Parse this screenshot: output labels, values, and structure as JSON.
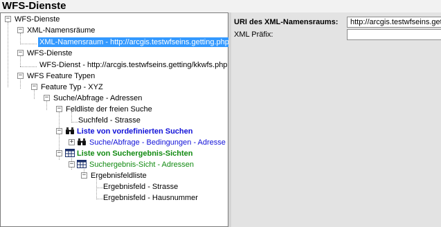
{
  "window": {
    "title": "WFS-Dienste"
  },
  "tree": {
    "root": "WFS-Dienste",
    "xml_namespaces": "XML-Namensräume",
    "xml_namespace_item": "XML-Namensraum - http://arcgis.testwfseins.getting.php",
    "wfs_services": "WFS-Dienste",
    "wfs_service_item": "WFS-Dienst - http://arcgis.testwfseins.getting/kkwfs.php",
    "feature_types": "WFS Feature Typen",
    "feature_type": "Feature Typ - XYZ",
    "search_query": "Suche/Abfrage - Adressen",
    "free_search_fields": "Feldliste der freien Suche",
    "search_field": "Suchfeld - Strasse",
    "predefined_searches": "Liste von vordefinierten Suchen",
    "search_conditions": "Suche/Abfrage - Bedingungen - Adresse",
    "result_views": "Liste von Suchergebnis-Sichten",
    "result_view": "Suchergebnis-Sicht - Adressen",
    "result_field_list": "Ergebnisfeldliste",
    "result_field_street": "Ergebnisfeld - Strasse",
    "result_field_number": "Ergebnisfeld - Hausnummer"
  },
  "properties": {
    "uri_label": "URI des XML-Namensraums:",
    "uri_value": "http://arcgis.testwfseins.get",
    "prefix_label": "XML Präfix:",
    "prefix_value": ""
  },
  "colors": {
    "selection": "#3399ff",
    "blue_node": "#1010d8",
    "green_node": "#118a11"
  },
  "icons": [
    "binoculars-icon",
    "table-icon"
  ]
}
